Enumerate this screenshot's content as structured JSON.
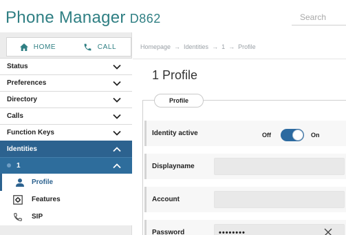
{
  "header": {
    "title": "Phone Manager",
    "model": "D862",
    "search_placeholder": "Search"
  },
  "topnav": {
    "home": "HOME",
    "call": "CALL"
  },
  "menu": {
    "items": [
      {
        "label": "Status"
      },
      {
        "label": "Preferences"
      },
      {
        "label": "Directory"
      },
      {
        "label": "Calls"
      },
      {
        "label": "Function Keys"
      },
      {
        "label": "Identities"
      }
    ],
    "identity": "1",
    "subitems": [
      {
        "label": "Profile",
        "icon": "person-icon"
      },
      {
        "label": "Features",
        "icon": "gear-box-icon"
      },
      {
        "label": "SIP",
        "icon": "sip-phone-icon"
      }
    ]
  },
  "breadcrumb": [
    "Homepage",
    "Identities",
    "1",
    "Profile"
  ],
  "breadcrumb_separator": "→",
  "page": {
    "heading": "1 Profile",
    "tab": "Profile",
    "identity_active_label": "Identity active",
    "toggle_off": "Off",
    "toggle_on": "On",
    "toggle_state": "on",
    "displayname_label": "Displayname",
    "displayname_value": "",
    "account_label": "Account",
    "account_value": "",
    "password_label": "Password",
    "password_value": "••••••••"
  },
  "colors": {
    "brand": "#2f7f83",
    "active_menu": "#2c628f",
    "toggle": "#2c6aa0"
  }
}
